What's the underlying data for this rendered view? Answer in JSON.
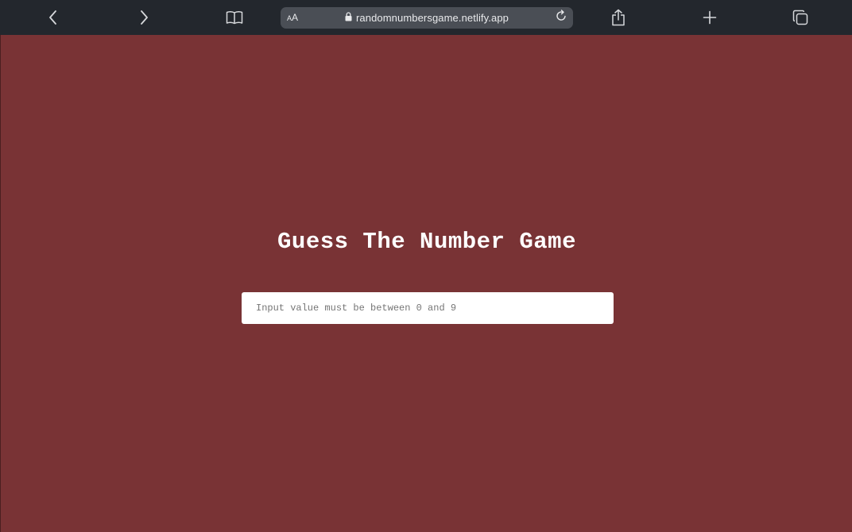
{
  "browser": {
    "url": "randomnumbersgame.netlify.app",
    "aa_label_small": "A",
    "aa_label_large": "A",
    "icons": {
      "back": "chevron-left-icon",
      "forward": "chevron-right-icon",
      "bookmarks": "book-icon",
      "secure": "lock-icon",
      "reload": "reload-icon",
      "share": "share-icon",
      "new_tab": "plus-icon",
      "tabs": "tabs-icon"
    },
    "toolbar_color": "#23272d"
  },
  "page": {
    "background_color": "#793335",
    "title": "Guess The Number Game",
    "input": {
      "value": "",
      "placeholder": "Input value must be between 0 and 9"
    }
  }
}
